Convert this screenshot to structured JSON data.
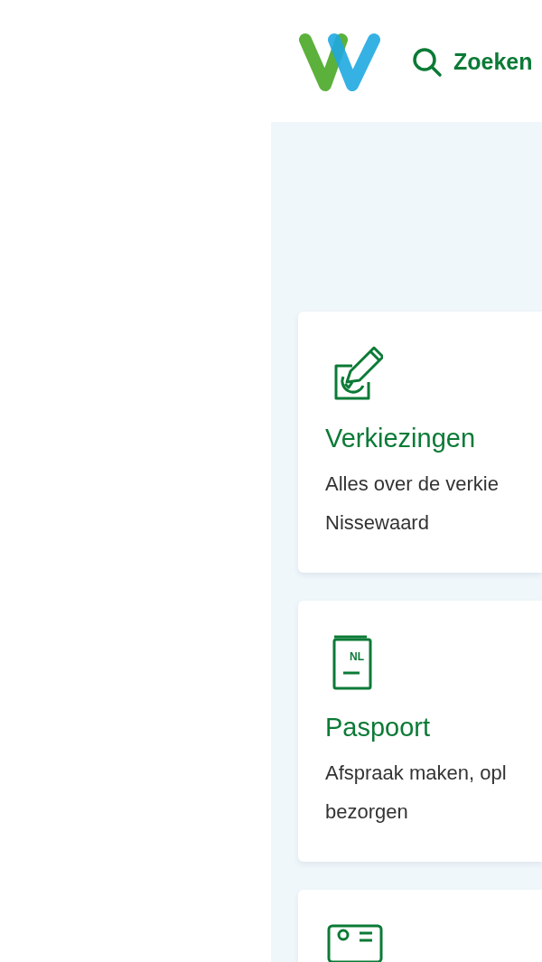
{
  "header": {
    "search_label": "Zoeken"
  },
  "cards": [
    {
      "kind": "ballot",
      "title": "Verkiezingen",
      "description": "Alles over de verkie Nissewaard"
    },
    {
      "kind": "passport",
      "title": "Paspoort",
      "description": "Afspraak maken, opl bezorgen",
      "icon_label": "NL"
    },
    {
      "kind": "idcard"
    }
  ]
}
